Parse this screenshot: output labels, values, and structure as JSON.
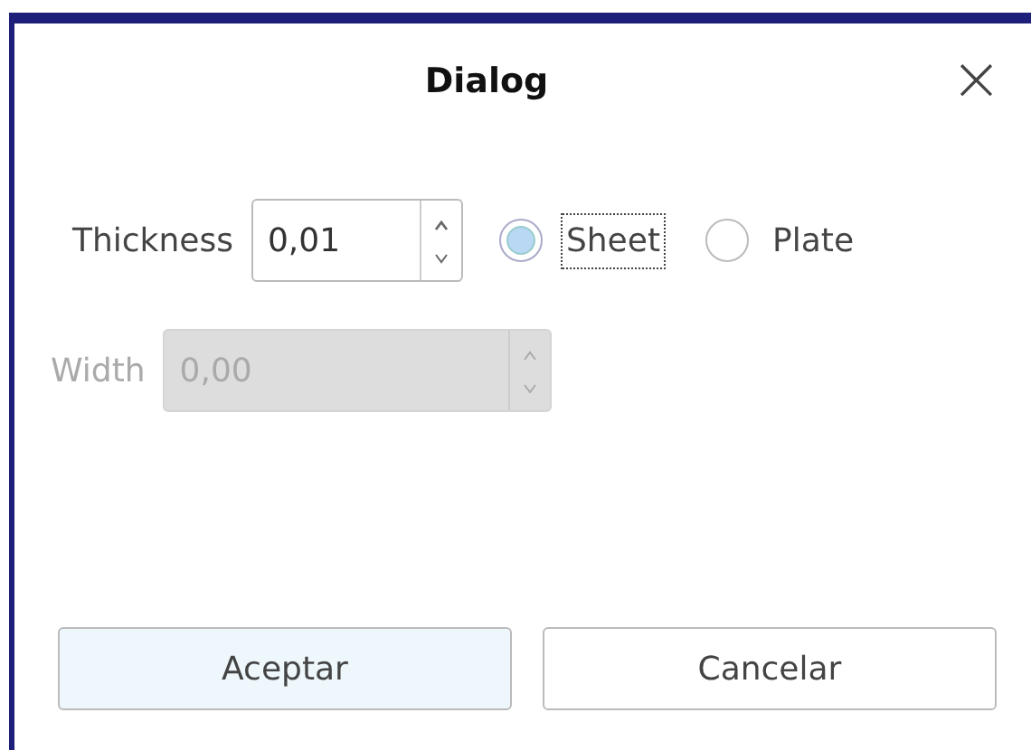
{
  "window": {
    "title": "Dialog",
    "close": "×"
  },
  "thickness": {
    "label": "Thickness",
    "value": "0,01",
    "disabled": false
  },
  "options": [
    {
      "label": "Sheet",
      "selected": true,
      "focused": true
    },
    {
      "label": "Plate",
      "selected": false,
      "focused": false
    }
  ],
  "width": {
    "label": "Width",
    "value": "0,00",
    "disabled": true
  },
  "buttons": [
    {
      "label": "Aceptar",
      "default": true
    },
    {
      "label": "Cancelar",
      "default": false
    }
  ]
}
